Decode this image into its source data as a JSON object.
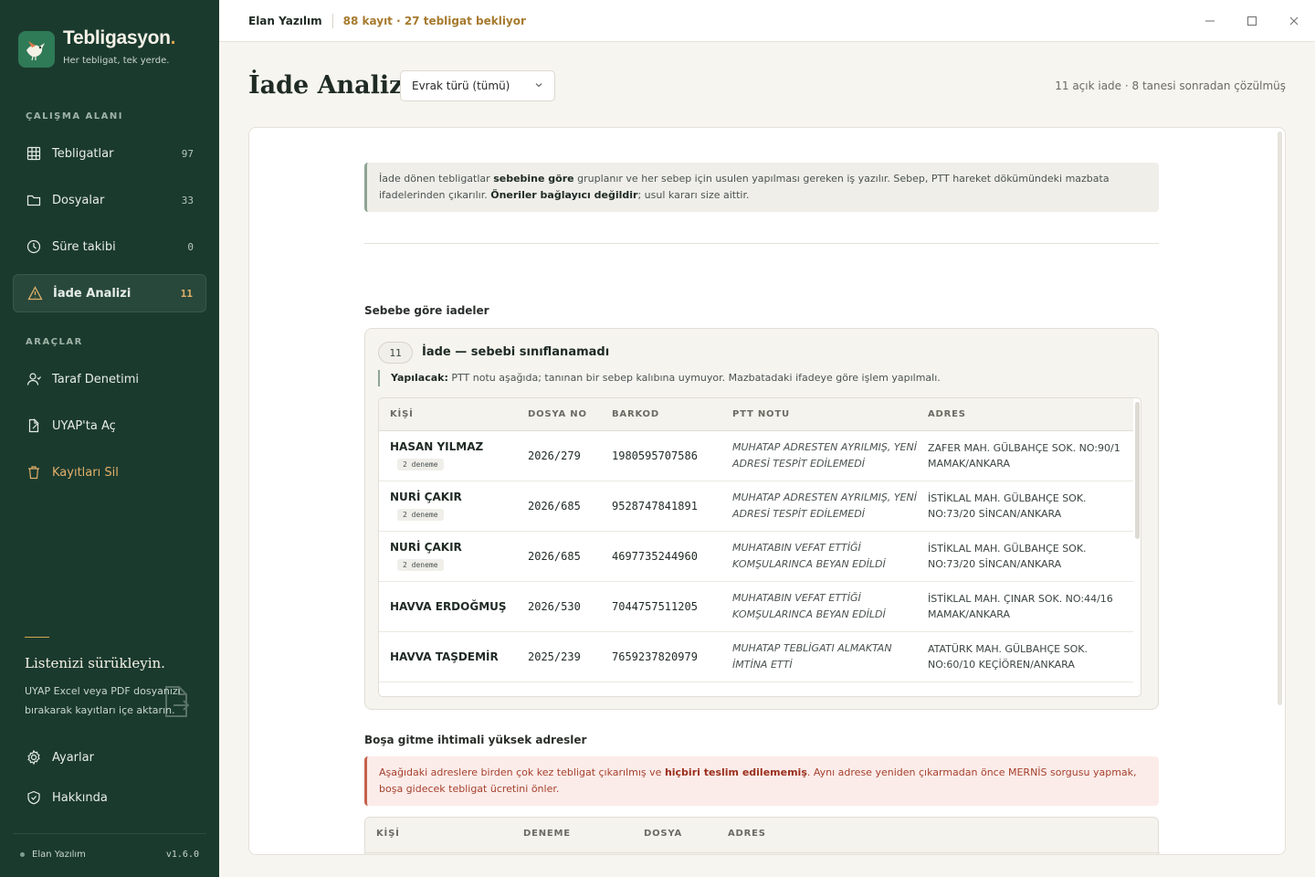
{
  "app": {
    "brand_name": "Tebligasyon",
    "brand_dot": ".",
    "tagline": "Her tebligat, tek yerde."
  },
  "sidebar": {
    "workspace_label": "ÇALIŞMA ALANI",
    "workspace_items": [
      {
        "label": "Tebligatlar",
        "count": "97",
        "icon": "grid-icon"
      },
      {
        "label": "Dosyalar",
        "count": "33",
        "icon": "folder-icon"
      },
      {
        "label": "Süre takibi",
        "count": "0",
        "icon": "clock-icon"
      },
      {
        "label": "İade Analizi",
        "count": "11",
        "icon": "warning-icon"
      }
    ],
    "tools_label": "ARAÇLAR",
    "tools_items": [
      {
        "label": "Taraf Denetimi",
        "icon": "user-icon"
      },
      {
        "label": "UYAP'ta Aç",
        "icon": "external-link-icon"
      },
      {
        "label": "Kayıtları Sil",
        "icon": "trash-icon"
      }
    ],
    "drop": {
      "title": "Listenizi sürükleyin.",
      "description": "UYAP Excel veya PDF dosyanızı bırakarak kayıtları içe aktarın."
    },
    "bottom_items": [
      {
        "label": "Ayarlar",
        "icon": "gear-icon"
      },
      {
        "label": "Hakkında",
        "icon": "shield-icon"
      }
    ],
    "footer": {
      "user": "Elan Yazılım",
      "version": "v1.6.0"
    }
  },
  "titlebar": {
    "company": "Elan Yazılım",
    "status": "88 kayıt · 27 tebligat bekliyor"
  },
  "header": {
    "title": "İade Analizi",
    "filter_value": "Evrak türü (tümü)",
    "stat": "11 açık iade · 8 tanesi sonradan çözülmüş"
  },
  "info": {
    "p1": "İade dönen tebligatlar ",
    "b1": "sebebine göre",
    "p2": " gruplanır ve her sebep için usulen yapılması gereken iş yazılır. Sebep, PTT hareket dökümündeki mazbata ifadelerinden çıkarılır. ",
    "b2": "Öneriler bağlayıcı değildir",
    "p3": "; usul kararı size aittir."
  },
  "section1_title": "Sebebe göre iadeler",
  "group": {
    "count": "11",
    "title": "İade — sebebi sınıflanamadı",
    "todo_label": "Yapılacak:",
    "todo_text": " PTT notu aşağıda; tanınan bir sebep kalıbına uymuyor. Mazbatadaki ifadeye göre işlem yapılmalı.",
    "columns": [
      "KİŞİ",
      "DOSYA NO",
      "BARKOD",
      "PTT NOTU",
      "ADRES"
    ],
    "rows": [
      {
        "person": "HASAN YILMAZ",
        "tries": "2 deneme",
        "file": "2026/279",
        "barcode": "1980595707586",
        "note": "MUHATAP ADRESTEN AYRILMIŞ, YENİ ADRESİ TESPİT EDİLEMEDİ",
        "address": "ZAFER MAH. GÜLBAHÇE SOK. NO:90/1 MAMAK/ANKARA"
      },
      {
        "person": "NURİ ÇAKIR",
        "tries": "2 deneme",
        "file": "2026/685",
        "barcode": "9528747841891",
        "note": "MUHATAP ADRESTEN AYRILMIŞ, YENİ ADRESİ TESPİT EDİLEMEDİ",
        "address": "İSTİKLAL MAH. GÜLBAHÇE SOK. NO:73/20 SİNCAN/ANKARA"
      },
      {
        "person": "NURİ ÇAKIR",
        "tries": "2 deneme",
        "file": "2026/685",
        "barcode": "4697735244960",
        "note": "MUHATABIN VEFAT ETTİĞİ KOMŞULARINCA BEYAN EDİLDİ",
        "address": "İSTİKLAL MAH. GÜLBAHÇE SOK. NO:73/20 SİNCAN/ANKARA"
      },
      {
        "person": "HAVVA ERDOĞMUŞ",
        "tries": "",
        "file": "2026/530",
        "barcode": "7044757511205",
        "note": "MUHATABIN VEFAT ETTİĞİ KOMŞULARINCA BEYAN EDİLDİ",
        "address": "İSTİKLAL MAH. ÇINAR SOK. NO:44/16 MAMAK/ANKARA"
      },
      {
        "person": "HAVVA TAŞDEMİR",
        "tries": "",
        "file": "2025/239",
        "barcode": "7659237820979",
        "note": "MUHATAP TEBLİGATI ALMAKTAN İMTİNA ETTİ",
        "address": "ATATÜRK MAH. GÜLBAHÇE SOK. NO:60/10 KEÇİÖREN/ANKARA"
      }
    ]
  },
  "section2_title": "Boşa gitme ihtimali yüksek adresler",
  "warning": {
    "p1": "Aşağıdaki adreslere birden çok kez tebligat çıkarılmış ve ",
    "b1": "hiçbiri teslim edilememiş",
    "p2": ". Aynı adrese yeniden çıkarmadan önce MERNİS sorgusu yapmak, boşa gidecek tebligat ücretini önler."
  },
  "table2": {
    "columns": [
      "KİŞİ",
      "DENEME",
      "DOSYA",
      "ADRES"
    ]
  },
  "colors": {
    "sidebar_bg": "#1b3a2e",
    "accent": "#d4a64a",
    "danger": "#c4614c"
  }
}
